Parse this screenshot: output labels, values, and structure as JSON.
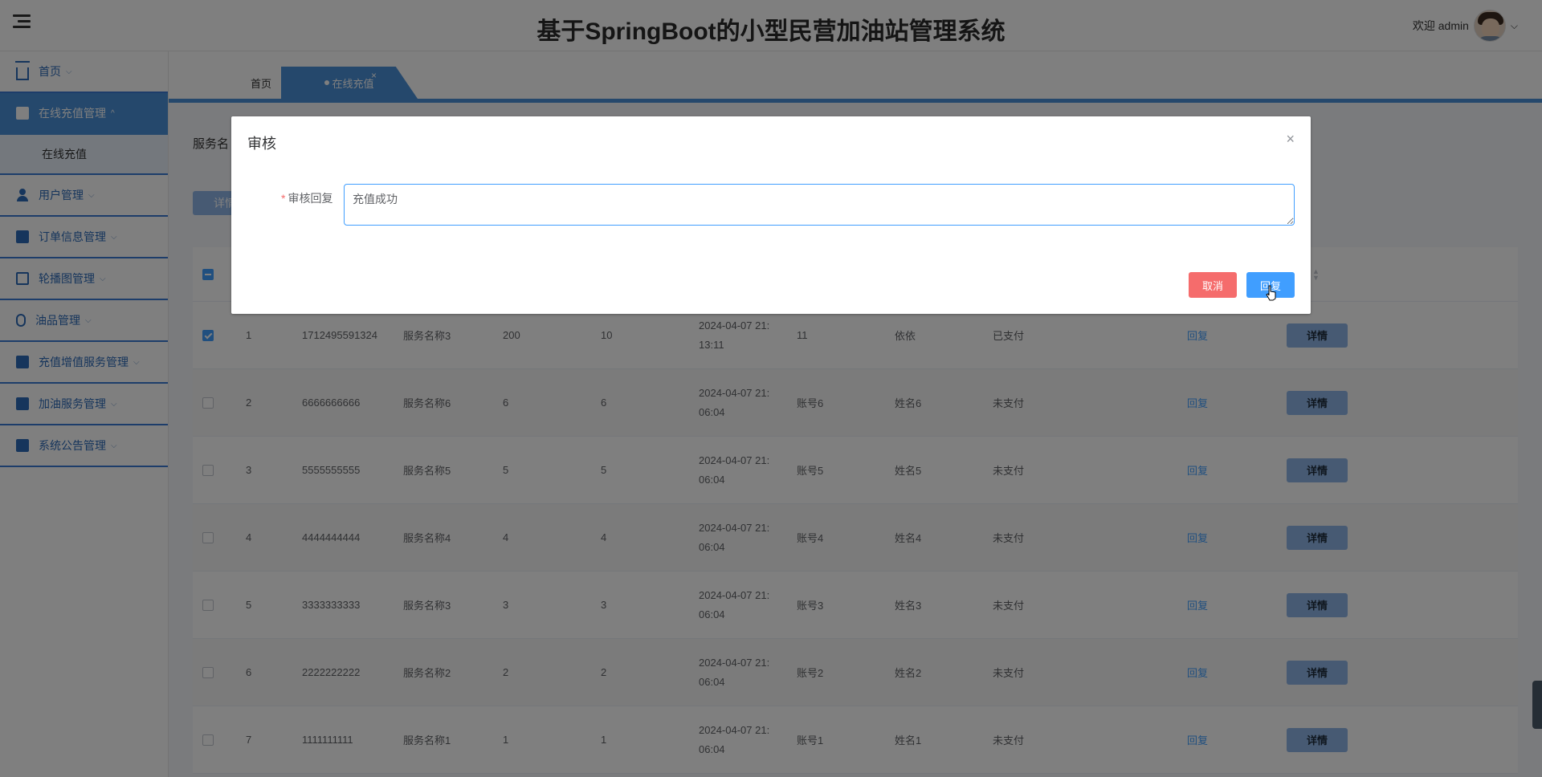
{
  "header": {
    "title": "基于SpringBoot的小型民营加油站管理系统",
    "welcome": "欢迎 admin",
    "caret": "⌵"
  },
  "sidebar": {
    "items": [
      {
        "label": "首页",
        "icon": "home-icon",
        "chevron": "⌵"
      },
      {
        "label": "在线充值管理",
        "icon": "briefcase-icon",
        "chevron": "^",
        "active": true
      },
      {
        "label": "用户管理",
        "icon": "user-icon",
        "chevron": "⌵"
      },
      {
        "label": "订单信息管理",
        "icon": "book-icon",
        "chevron": "⌵"
      },
      {
        "label": "轮播图管理",
        "icon": "wallet-icon",
        "chevron": "⌵"
      },
      {
        "label": "油品管理",
        "icon": "mouse-icon",
        "chevron": "⌵"
      },
      {
        "label": "充值增值服务管理",
        "icon": "columns-icon",
        "chevron": "⌵"
      },
      {
        "label": "加油服务管理",
        "icon": "case-icon",
        "chevron": "⌵"
      },
      {
        "label": "系统公告管理",
        "icon": "bus-icon",
        "chevron": "⌵"
      }
    ],
    "submenu": {
      "label": "在线充值"
    }
  },
  "tabs": {
    "home": "首页",
    "active": "在线充值",
    "close": "×"
  },
  "filters": {
    "label_partial": "服务名"
  },
  "toolbar": {
    "detail_partial": "详情"
  },
  "table": {
    "rows": [
      {
        "index": "1",
        "order_no": "1712495591324",
        "service": "服务名称3",
        "amount": "200",
        "bonus": "10",
        "time_line1": "2024-04-07 21:",
        "time_line2": "13:11",
        "account": "11",
        "name": "依依",
        "status": "已支付",
        "reply": "回复",
        "detail": "详情",
        "checked": true
      },
      {
        "index": "2",
        "order_no": "6666666666",
        "service": "服务名称6",
        "amount": "6",
        "bonus": "6",
        "time_line1": "2024-04-07 21:",
        "time_line2": "06:04",
        "account": "账号6",
        "name": "姓名6",
        "status": "未支付",
        "reply": "回复",
        "detail": "详情",
        "checked": false
      },
      {
        "index": "3",
        "order_no": "5555555555",
        "service": "服务名称5",
        "amount": "5",
        "bonus": "5",
        "time_line1": "2024-04-07 21:",
        "time_line2": "06:04",
        "account": "账号5",
        "name": "姓名5",
        "status": "未支付",
        "reply": "回复",
        "detail": "详情",
        "checked": false
      },
      {
        "index": "4",
        "order_no": "4444444444",
        "service": "服务名称4",
        "amount": "4",
        "bonus": "4",
        "time_line1": "2024-04-07 21:",
        "time_line2": "06:04",
        "account": "账号4",
        "name": "姓名4",
        "status": "未支付",
        "reply": "回复",
        "detail": "详情",
        "checked": false
      },
      {
        "index": "5",
        "order_no": "3333333333",
        "service": "服务名称3",
        "amount": "3",
        "bonus": "3",
        "time_line1": "2024-04-07 21:",
        "time_line2": "06:04",
        "account": "账号3",
        "name": "姓名3",
        "status": "未支付",
        "reply": "回复",
        "detail": "详情",
        "checked": false
      },
      {
        "index": "6",
        "order_no": "2222222222",
        "service": "服务名称2",
        "amount": "2",
        "bonus": "2",
        "time_line1": "2024-04-07 21:",
        "time_line2": "06:04",
        "account": "账号2",
        "name": "姓名2",
        "status": "未支付",
        "reply": "回复",
        "detail": "详情",
        "checked": false
      },
      {
        "index": "7",
        "order_no": "1111111111",
        "service": "服务名称1",
        "amount": "1",
        "bonus": "1",
        "time_line1": "2024-04-07 21:",
        "time_line2": "06:04",
        "account": "账号1",
        "name": "姓名1",
        "status": "未支付",
        "reply": "回复",
        "detail": "详情",
        "checked": false
      }
    ]
  },
  "dialog": {
    "title": "审核",
    "close": "×",
    "field_label": "审核回复",
    "required_mark": "*",
    "field_value": "充值成功",
    "cancel_label": "取消",
    "reply_label": "回复"
  },
  "colors": {
    "accent": "#4a90d9",
    "danger": "#f56c6c",
    "primary": "#409eff"
  }
}
